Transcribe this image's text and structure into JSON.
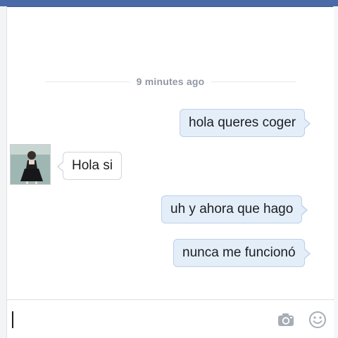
{
  "conversation": {
    "timestamp": "9 minutes ago",
    "messages": [
      {
        "sender": "me",
        "text": "hola queres coger"
      },
      {
        "sender": "contact",
        "text": "Hola si"
      },
      {
        "sender": "me",
        "text": "uh y ahora que hago"
      },
      {
        "sender": "me",
        "text": "nunca me funcionó"
      }
    ]
  },
  "composer": {
    "value": "",
    "icons": [
      "camera-icon",
      "emoji-icon"
    ]
  },
  "colors": {
    "outgoing_bubble": "#e4eef9",
    "incoming_bubble": "#ffffff",
    "timestamp": "#9197a3",
    "header": "#4b6aa8"
  }
}
